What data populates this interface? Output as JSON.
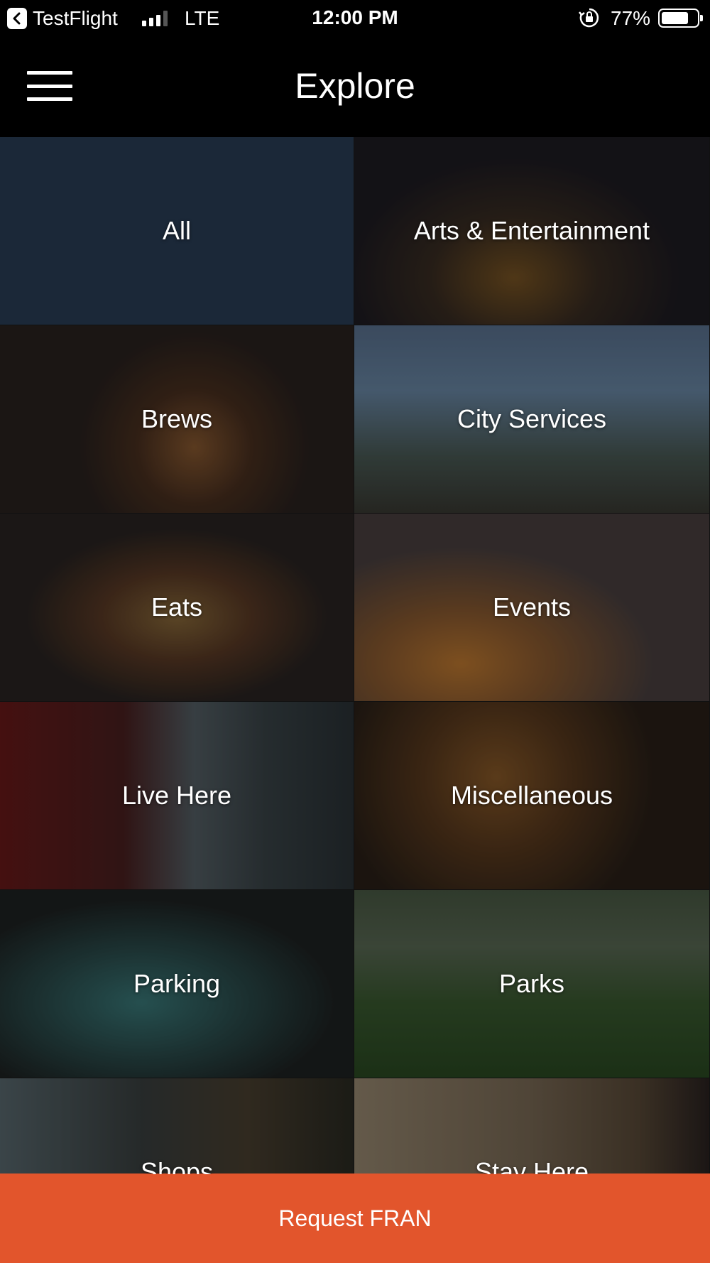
{
  "status_bar": {
    "back_app": "TestFlight",
    "network": "LTE",
    "time": "12:00 PM",
    "battery_percent": "77%",
    "battery_level": 0.77,
    "icons": [
      "back-arrow-icon",
      "signal-icon",
      "rotation-lock-icon",
      "battery-icon"
    ]
  },
  "header": {
    "title": "Explore",
    "menu_icon": "hamburger-menu-icon"
  },
  "categories": [
    {
      "label": "All"
    },
    {
      "label": "Arts & Entertainment"
    },
    {
      "label": "Brews"
    },
    {
      "label": "City Services"
    },
    {
      "label": "Eats"
    },
    {
      "label": "Events"
    },
    {
      "label": "Live Here"
    },
    {
      "label": "Miscellaneous"
    },
    {
      "label": "Parking"
    },
    {
      "label": "Parks"
    },
    {
      "label": "Shops"
    },
    {
      "label": "Stay Here"
    }
  ],
  "request_button": {
    "label": "Request FRAN",
    "color": "#e2552c"
  },
  "colors": {
    "all_tile": "#1b2838",
    "header_bg": "#000000"
  }
}
